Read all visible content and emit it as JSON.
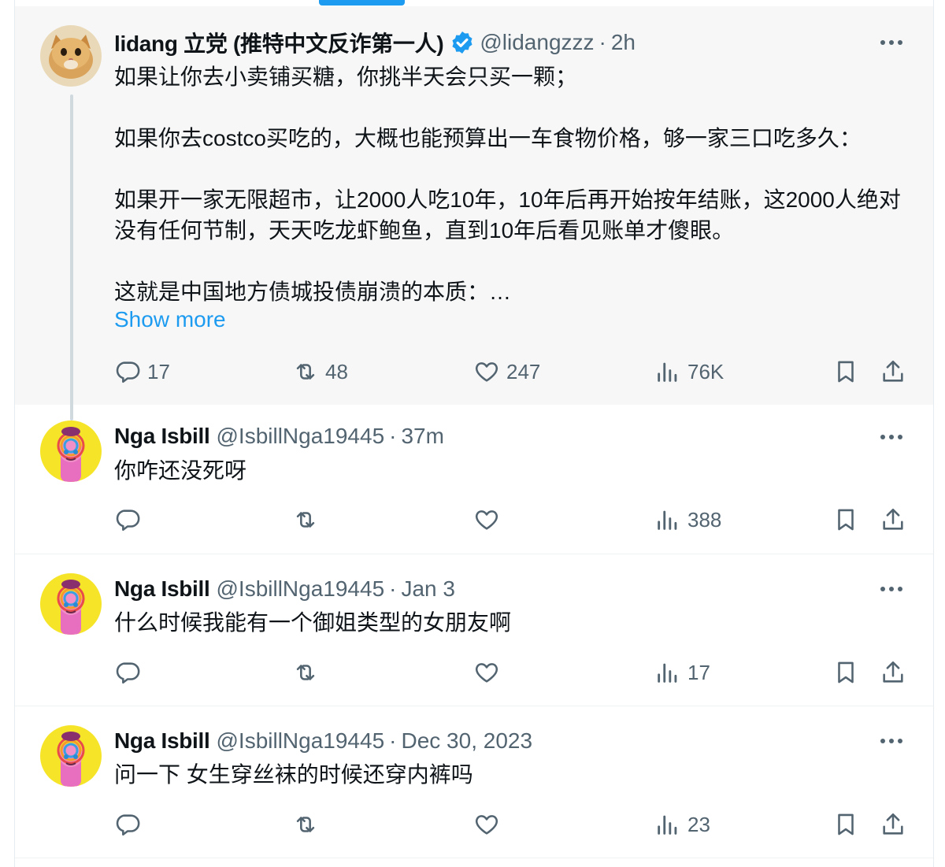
{
  "tweets": [
    {
      "display_name": "lidang 立党 (推特中文反诈第一人)",
      "verified": true,
      "handle": "@lidangzzz",
      "separator": "·",
      "time": "2h",
      "text": "如果让你去小卖铺买糖，你挑半天会只买一颗；\n\n如果你去costco买吃的，大概也能预算出一车食物价格，够一家三口吃多久：\n\n如果开一家无限超市，让2000人吃10年，10年后再开始按年结账，这2000人绝对没有任何节制，天天吃龙虾鲍鱼，直到10年后看见账单才傻眼。\n\n这就是中国地方债城投债崩溃的本质：…",
      "show_more": "Show more",
      "replies": "17",
      "retweets": "48",
      "likes": "247",
      "views": "76K"
    },
    {
      "display_name": "Nga Isbill",
      "handle": "@IsbillNga19445",
      "separator": "·",
      "time": "37m",
      "text": "你咋还没死呀",
      "views": "388"
    },
    {
      "display_name": "Nga Isbill",
      "handle": "@IsbillNga19445",
      "separator": "·",
      "time": "Jan 3",
      "text": "什么时候我能有一个御姐类型的女朋友啊",
      "views": "17"
    },
    {
      "display_name": "Nga Isbill",
      "handle": "@IsbillNga19445",
      "separator": "·",
      "time": "Dec 30, 2023",
      "text": "问一下 女生穿丝袜的时候还穿内裤吗",
      "views": "23"
    }
  ],
  "icons": {
    "reply": "reply-icon",
    "retweet": "retweet-icon",
    "like": "heart-icon",
    "views": "views-icon",
    "bookmark": "bookmark-icon",
    "share": "share-icon",
    "more": "more-icon",
    "verified": "verified-badge-icon"
  },
  "colors": {
    "accent": "#1d9bf0",
    "secondary_text": "#536471",
    "highlight_bg": "#f7f7f7",
    "thread_line": "#cfd9de"
  }
}
